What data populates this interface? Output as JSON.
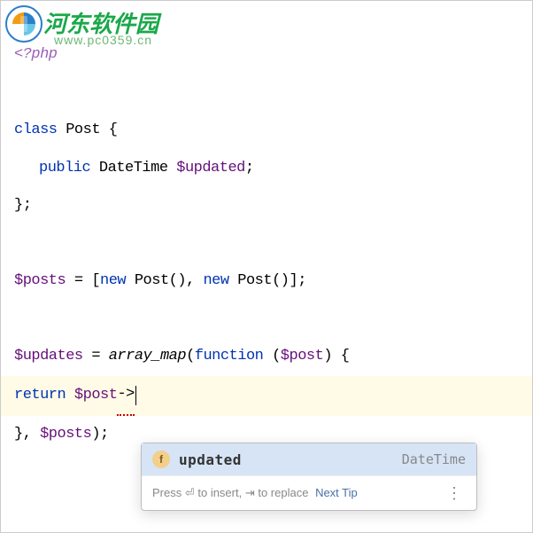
{
  "watermark": {
    "title": "河东软件园",
    "url": "www.pc0359.cn"
  },
  "code": {
    "php_open": "<?php",
    "class_kw": "class",
    "class_name": "Post",
    "brace_open": "{",
    "public_kw": "public",
    "type_datetime": "DateTime",
    "prop_updated": "$updated",
    "semicolon": ";",
    "brace_close_semi": "};",
    "var_posts": "$posts",
    "equals": " = ",
    "bracket_open": "[",
    "new_kw": "new",
    "post_ctor": "Post",
    "parens": "()",
    "comma": ", ",
    "bracket_close_semi": "];",
    "var_updates": "$updates",
    "array_map": "array_map",
    "paren_open": "(",
    "function_kw": "function",
    "param_post": "$post",
    "paren_close": ")",
    "return_kw": "return",
    "arrow": "->",
    "closure_close": "}, ",
    "posts_ref": "$posts",
    "end_paren_semi": ");"
  },
  "autocomplete": {
    "icon_letter": "f",
    "item_name": "updated",
    "item_type": "DateTime",
    "hint_press": "Press ",
    "hint_enter_glyph": "⏎",
    "hint_insert": " to insert, ",
    "hint_tab_glyph": "⇥",
    "hint_replace": " to replace ",
    "next_tip": "Next Tip",
    "more": "⋮"
  }
}
